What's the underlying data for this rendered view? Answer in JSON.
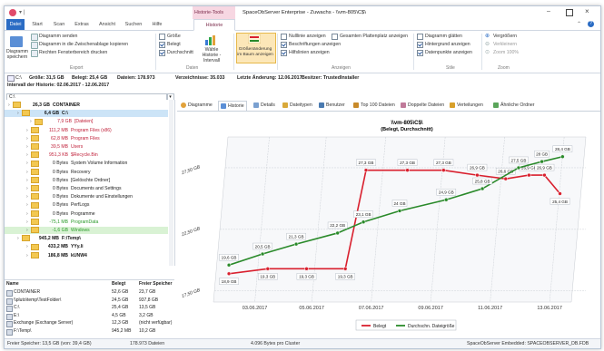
{
  "window": {
    "title": "SpaceObServer Enterprise - Zuwachs - \\\\vm-805\\C$\\",
    "context_tab": "Historie-Tools"
  },
  "tabs": [
    "Datei",
    "Start",
    "Scan",
    "Extras",
    "Ansicht",
    "Suchen",
    "Hilfe",
    "Historie"
  ],
  "ribbon": {
    "diagram_save": "Diagramm speichern",
    "send": "Diagramm senden",
    "copy": "Diagramm in die Zwischenablage kopieren",
    "print": "Rechten Fensterbereich drucken",
    "export_group": "Export",
    "size": "Größe",
    "used": "Belegt",
    "avg": "Durchschnitt",
    "choose_hist": "Wähle Historie -Intervall",
    "data_group": "Daten",
    "size_change": "Größenänderung im Baum anzeigen",
    "nulllinie": "Nulllinie anzeigen",
    "total_disk": "Gesamten Plattenplatz anzeigen",
    "labels": "Beschriftungen anzeigen",
    "helplines": "Hilfslinien anzeigen",
    "show_group": "Anzeigen",
    "smooth": "Diagramm glätten",
    "bg": "Hintergrund anzeigen",
    "points": "Datenpunkte anzeigen",
    "style_group": "Stile",
    "zoom_in": "Vergrößern",
    "zoom_out": "Verkleinern",
    "zoom_100": "Zoom 100%",
    "zoom_group": "Zoom"
  },
  "infobar": {
    "path": "C:\\",
    "size": "Größe: 31,5 GB",
    "used": "Belegt: 25,4 GB",
    "files": "Dateien: 178.973",
    "dirs": "Verzeichnisse: 35.033",
    "last_change": "Letzte Änderung: 12.06.2017",
    "owner": "Besitzer: TrustedInstaller",
    "interval": "Intervall der Historie: 02.06.2017 - 12.06.2017"
  },
  "path_input": "C:\\",
  "tree": [
    {
      "size": "26,3 GB",
      "name": "CONTAINER",
      "bold": true,
      "color": "#111",
      "indent": 4
    },
    {
      "size": "6,4 GB",
      "name": "C:\\",
      "bold": true,
      "color": "#111",
      "indent": 14,
      "selected": true
    },
    {
      "size": "7,9 GB",
      "name": "[Dateien]",
      "bold": false,
      "color": "#c0213a",
      "indent": 28
    },
    {
      "size": "111,2 MB",
      "name": "Program Files (x86)",
      "bold": false,
      "color": "#c0213a",
      "indent": 24
    },
    {
      "size": "62,8 MB",
      "name": "Program Files",
      "bold": false,
      "color": "#c0213a",
      "indent": 24
    },
    {
      "size": "39,5 MB",
      "name": "Users",
      "bold": false,
      "color": "#c0213a",
      "indent": 24
    },
    {
      "size": "951,3 KB",
      "name": "$Recycle.Bin",
      "bold": false,
      "color": "#c0213a",
      "indent": 24
    },
    {
      "size": "0 Bytes",
      "name": "System Volume Information",
      "bold": false,
      "color": "#222",
      "indent": 24
    },
    {
      "size": "0 Bytes",
      "name": "Recovery",
      "bold": false,
      "color": "#222",
      "indent": 24
    },
    {
      "size": "0 Bytes",
      "name": "[Gelöschte Ordner]",
      "bold": false,
      "color": "#222",
      "indent": 24
    },
    {
      "size": "0 Bytes",
      "name": "Documents and Settings",
      "bold": false,
      "color": "#222",
      "indent": 24
    },
    {
      "size": "0 Bytes",
      "name": "Dokumente und Einstellungen",
      "bold": false,
      "color": "#222",
      "indent": 24
    },
    {
      "size": "0 Bytes",
      "name": "PerfLogs",
      "bold": false,
      "color": "#222",
      "indent": 24
    },
    {
      "size": "0 Bytes",
      "name": "Programme",
      "bold": false,
      "color": "#222",
      "indent": 24
    },
    {
      "size": "-75,1 MB",
      "name": "ProgramData",
      "bold": false,
      "color": "#2a9a2a",
      "indent": 24
    },
    {
      "size": "-1,6 GB",
      "name": "Windows",
      "bold": false,
      "color": "#2a9a2a",
      "indent": 24,
      "greenbg": true
    },
    {
      "size": "945,2 MB",
      "name": "F:\\Temp\\",
      "bold": true,
      "color": "#111",
      "indent": 14
    },
    {
      "size": "433,2 MB",
      "name": "YYy.li",
      "bold": true,
      "color": "#111",
      "indent": 24
    },
    {
      "size": "186,8 MB",
      "name": "kUNW4",
      "bold": true,
      "color": "#111",
      "indent": 24
    }
  ],
  "table": {
    "headers": [
      "Name",
      "Belegt",
      "Freier Speicher"
    ],
    "rows": [
      [
        "CONTAINER",
        "52,6 GB",
        "23,7 GB"
      ],
      [
        "\\\\pluto\\temp\\TestFolder\\",
        "24,5 GB",
        "937,8 GB"
      ],
      [
        "C:\\",
        "25,4 GB",
        "13,5 GB"
      ],
      [
        "E:\\",
        "4,5 GB",
        "3,2 GB"
      ],
      [
        "Exchange (Exchange Server)",
        "12,3 GB",
        "(nicht verfügbar)"
      ],
      [
        "F:\\Temp\\",
        "945,2 MB",
        "10,2 GB"
      ]
    ]
  },
  "status": {
    "free": "Freier Speicher: 13,5 GB (von: 39,4 GB)",
    "files": "178.973 Dateien",
    "cluster": "4.096 Bytes pro Cluster",
    "embedded": "SpaceObServer Embedded: SPACEOBSERVER_DB.FDB"
  },
  "chart_tabs": [
    "Diagramme",
    "Historie",
    "Details",
    "Dateitypen",
    "Benutzer",
    "Top 100 Dateien",
    "Doppelte Dateien",
    "Verteilungen",
    "Ähnliche Ordner"
  ],
  "chart_data": {
    "type": "line",
    "title": "\\\\vm-805\\C$\\",
    "subtitle": "(Belegt, Durchschnitt)",
    "x_ticks": [
      "03.06.2017",
      "05.06.2017",
      "07.06.2017",
      "09.06.2017",
      "11.06.2017",
      "13.06.2017"
    ],
    "y_ticks": [
      "17,50 GB",
      "22,50 GB",
      "27,50 GB"
    ],
    "series": [
      {
        "name": "Belegt",
        "color": "#d9202e",
        "points": [
          {
            "x": 0.0,
            "y": 18.9,
            "label": "18,9 GB"
          },
          {
            "x": 1.5,
            "y": 19.3,
            "label": "19,3 GB"
          },
          {
            "x": 3.0,
            "y": 19.3,
            "label": "19,3 GB"
          },
          {
            "x": 4.5,
            "y": 19.3,
            "label": "19,3 GB"
          },
          {
            "x": 5.3,
            "y": 27.3,
            "label": "27,3 GB"
          },
          {
            "x": 6.9,
            "y": 27.3,
            "label": "27,3 GB"
          },
          {
            "x": 8.3,
            "y": 27.3,
            "label": "27,3 GB"
          },
          {
            "x": 9.6,
            "y": 26.9,
            "label": "26,9 GB"
          },
          {
            "x": 10.7,
            "y": 26.6,
            "label": "26,6 GB"
          },
          {
            "x": 11.6,
            "y": 26.9,
            "label": "26,9 GB"
          },
          {
            "x": 12.2,
            "y": 26.9,
            "label": "26,9 GB"
          },
          {
            "x": 12.8,
            "y": 25.4,
            "label": "25,4 GB"
          }
        ]
      },
      {
        "name": "Durchschn. Dateigröße",
        "color": "#2a8a2a",
        "points": [
          {
            "x": 0.0,
            "y": 19.6,
            "label": "19,6 GB"
          },
          {
            "x": 1.3,
            "y": 20.5,
            "label": "20,5 GB"
          },
          {
            "x": 2.6,
            "y": 21.3,
            "label": "21,3 GB"
          },
          {
            "x": 4.2,
            "y": 22.2,
            "label": "22,2 GB"
          },
          {
            "x": 5.2,
            "y": 23.1,
            "label": "23,1 GB"
          },
          {
            "x": 6.6,
            "y": 24.0,
            "label": "24 GB"
          },
          {
            "x": 8.4,
            "y": 24.9,
            "label": "24,9 GB"
          },
          {
            "x": 9.8,
            "y": 25.8,
            "label": "25,8 GB"
          },
          {
            "x": 11.2,
            "y": 27.5,
            "label": "27,5 GB"
          },
          {
            "x": 12.1,
            "y": 28.0,
            "label": "28 GB"
          },
          {
            "x": 12.9,
            "y": 28.4,
            "label": "28,4 GB"
          }
        ]
      }
    ],
    "xlim": [
      -0.6,
      13.8
    ],
    "ylim": [
      16.6,
      30.0
    ],
    "legend": "bottom"
  }
}
